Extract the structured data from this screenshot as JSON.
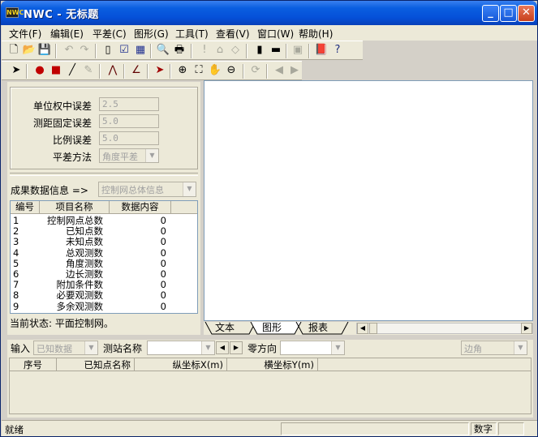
{
  "window": {
    "app_badge": "NWC",
    "title": "NWC - 无标题"
  },
  "titlebar_buttons": {
    "minimize": "_",
    "maximize": "□",
    "close": "✕"
  },
  "menu": [
    {
      "label": "文件(F)"
    },
    {
      "label": "编辑(E)"
    },
    {
      "label": "平差(C)"
    },
    {
      "label": "图形(G)"
    },
    {
      "label": "工具(T)"
    },
    {
      "label": "查看(V)"
    },
    {
      "label": "窗口(W)"
    },
    {
      "label": "帮助(H)"
    }
  ],
  "params": {
    "weight_error_label": "单位权中误差",
    "weight_error_value": "2.5",
    "fixed_error_label": "测距固定误差",
    "fixed_error_value": "5.0",
    "ratio_error_label": "比例误差",
    "ratio_error_value": "5.0",
    "method_label": "平差方法",
    "method_value": "角度平差"
  },
  "results": {
    "label": "成果数据信息 =>",
    "select_value": "控制网总体信息",
    "columns": [
      "编号",
      "项目名称",
      "数据内容"
    ],
    "rows": [
      {
        "no": "1",
        "name": "控制网点总数",
        "value": "0"
      },
      {
        "no": "2",
        "name": "已知点数",
        "value": "0"
      },
      {
        "no": "3",
        "name": "未知点数",
        "value": "0"
      },
      {
        "no": "4",
        "name": "总观测数",
        "value": "0"
      },
      {
        "no": "5",
        "name": "角度测数",
        "value": "0"
      },
      {
        "no": "6",
        "name": "边长测数",
        "value": "0"
      },
      {
        "no": "7",
        "name": "附加条件数",
        "value": "0"
      },
      {
        "no": "8",
        "name": "必要观测数",
        "value": "0"
      },
      {
        "no": "9",
        "name": "多余观测数",
        "value": "0"
      }
    ]
  },
  "current_state": "当前状态: 平面控制网。",
  "tabs": [
    {
      "label": "文本"
    },
    {
      "label": "图形"
    },
    {
      "label": "报表"
    }
  ],
  "input_bar": {
    "input_label": "输入",
    "input_select": "已知数据",
    "station_label": "测站名称",
    "zero_dir_label": "零方向",
    "angle_select": "边角"
  },
  "known_points": {
    "columns": [
      "序号",
      "已知点名称",
      "纵坐标X(m)",
      "横坐标Y(m)"
    ]
  },
  "statusbar": {
    "ready": "就绪",
    "numlock": "数字"
  }
}
